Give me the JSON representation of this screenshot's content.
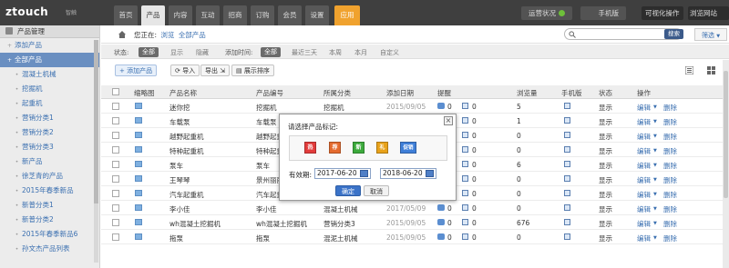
{
  "app": {
    "logo": "ztouch",
    "logo_sub": "智触"
  },
  "nav": {
    "items": [
      "首页",
      "产品",
      "内容",
      "互动",
      "招商",
      "订购",
      "会员",
      "设置"
    ],
    "active_index": 1,
    "apps_label": "应用"
  },
  "topbar": {
    "status_label": "运营状况",
    "mobile_label": "手机版",
    "visual_edit_label": "可视化操作",
    "browse_site_label": "浏览网站"
  },
  "sidebar": {
    "header": "产品管理",
    "items": [
      {
        "label": "添加产品",
        "level": 0,
        "bullet": "+"
      },
      {
        "label": "全部产品",
        "level": 0,
        "bullet": "+",
        "active": true
      },
      {
        "label": "混凝土机械",
        "level": 1
      },
      {
        "label": "挖掘机",
        "level": 1
      },
      {
        "label": "起重机",
        "level": 1
      },
      {
        "label": "营销分类1",
        "level": 1
      },
      {
        "label": "营销分类2",
        "level": 1
      },
      {
        "label": "营销分类3",
        "level": 1
      },
      {
        "label": "新产品",
        "level": 1
      },
      {
        "label": "徐芝青的产品",
        "level": 1
      },
      {
        "label": "2015年春季新品",
        "level": 1
      },
      {
        "label": "新普分类1",
        "level": 1
      },
      {
        "label": "新普分类2",
        "level": 1
      },
      {
        "label": "2015年春季新品6",
        "level": 1
      },
      {
        "label": "孙文杰产品列表",
        "level": 1
      }
    ]
  },
  "breadcrumb": {
    "prefix": "您正在:",
    "link1": "浏览",
    "link2": "全部产品"
  },
  "search": {
    "placeholder": "",
    "button_label": "搜索",
    "filter_label": "筛选"
  },
  "filters": {
    "status_label": "状态:",
    "status_all": "全部",
    "status_options": [
      "显示",
      "隐藏"
    ],
    "time_label": "添加时间:",
    "time_all": "全部",
    "time_options": [
      "最近三天",
      "本周",
      "本月",
      "自定义"
    ]
  },
  "toolbar": {
    "add_label": "添加产品",
    "import_label": "导入",
    "export_label": "导出",
    "sort_label": "展示排序"
  },
  "table": {
    "columns": [
      "缩略图",
      "产品名称",
      "产品编号",
      "所属分类",
      "添加日期",
      "提醒",
      "浏览量",
      "手机版",
      "状态",
      "操作"
    ],
    "rows": [
      {
        "name": "迷你挖",
        "code": "挖掘机",
        "category": "挖掘机",
        "date": "2015/09/05",
        "c1": "0",
        "c2": "0",
        "views": "5",
        "status": "显示"
      },
      {
        "name": "车载泵",
        "code": "车载泵",
        "category": "混凝土机械",
        "date": "2015/09/05",
        "c1": "0",
        "c2": "0",
        "views": "1",
        "status": "显示"
      },
      {
        "name": "越野起重机",
        "code": "越野起重机",
        "category": "起重机",
        "date": "2015/09/05",
        "c1": "0",
        "c2": "0",
        "views": "0",
        "status": "显示"
      },
      {
        "name": "特种起重机",
        "code": "特种起重机",
        "category": "起重机",
        "date": "2015/09/05",
        "c1": "0",
        "c2": "0",
        "views": "0",
        "status": "显示"
      },
      {
        "name": "泵车",
        "code": "泵车",
        "category": "混凝土机械",
        "date": "2015/09/05",
        "c1": "0",
        "c2": "0",
        "views": "6",
        "status": "显示"
      },
      {
        "name": "王琴琴",
        "code": "景州丽丽",
        "category": "混凝土机械",
        "date": "2015/09/05",
        "c1": "0",
        "c2": "0",
        "views": "0",
        "status": "显示"
      },
      {
        "name": "汽车起重机",
        "code": "汽车起重机",
        "category": "起重机",
        "date": "2015/09/05",
        "c1": "0",
        "c2": "0",
        "views": "0",
        "status": "显示"
      },
      {
        "name": "李小佳",
        "code": "李小佳",
        "category": "混凝土机械",
        "date": "2017/05/09",
        "c1": "0",
        "c2": "0",
        "views": "0",
        "status": "显示"
      },
      {
        "name": "wh混凝土挖掘机",
        "code": "wh混凝土挖掘机",
        "category": "营销分类3",
        "date": "2015/09/05",
        "c1": "0",
        "c2": "0",
        "views": "676",
        "status": "显示"
      },
      {
        "name": "拖泵",
        "code": "拖泵",
        "category": "混泥土机械",
        "date": "2015/09/05",
        "c1": "0",
        "c2": "0",
        "views": "0",
        "status": "显示"
      }
    ],
    "op_edit": "编辑",
    "op_delete": "删除"
  },
  "modal": {
    "title": "请选择产品标记:",
    "close_symbol": "×",
    "tags": [
      {
        "glyph": "热",
        "color": "#e23b3b"
      },
      {
        "glyph": "荐",
        "color": "#e46b2f"
      },
      {
        "glyph": "新",
        "color": "#3caa3c"
      },
      {
        "glyph": "礼",
        "color": "#e8a21a"
      },
      {
        "glyph": "促销",
        "color": "#3f7fd8"
      }
    ],
    "valid_label": "有效期:",
    "date_from": "2017-06-20",
    "date_separator": "~",
    "date_to": "2018-06-20",
    "confirm_label": "确定",
    "cancel_label": "取消"
  }
}
